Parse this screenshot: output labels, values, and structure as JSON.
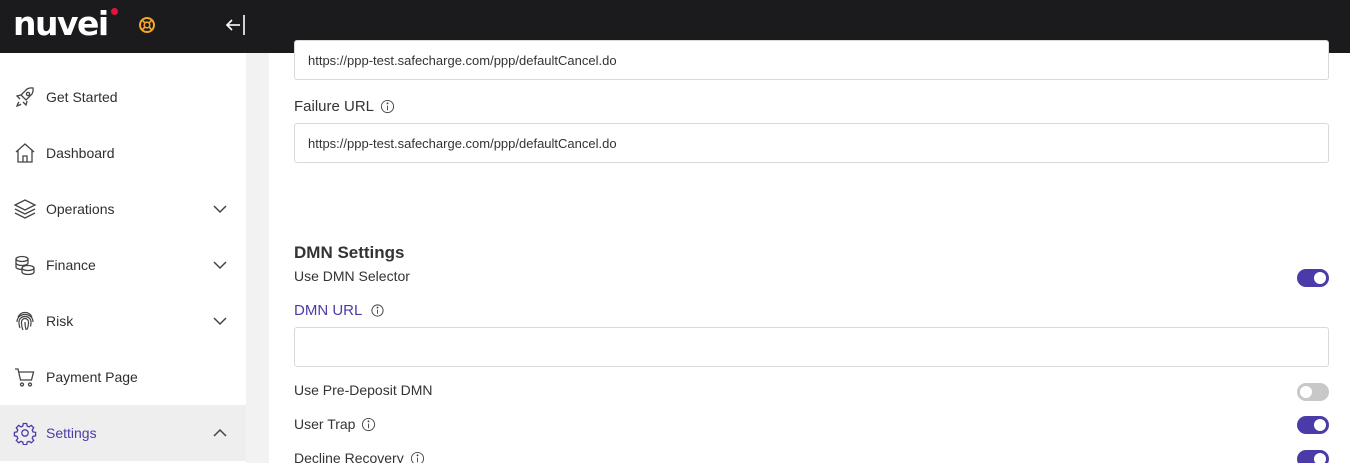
{
  "app": {
    "logo_text": "nuvei"
  },
  "sidebar": {
    "items": [
      {
        "label": "Get Started",
        "icon": "rocket-icon"
      },
      {
        "label": "Dashboard",
        "icon": "home-icon"
      },
      {
        "label": "Operations",
        "icon": "layers-icon",
        "expandable": true
      },
      {
        "label": "Finance",
        "icon": "coins-icon",
        "expandable": true
      },
      {
        "label": "Risk",
        "icon": "fingerprint-icon",
        "expandable": true
      },
      {
        "label": "Payment Page",
        "icon": "cart-icon"
      },
      {
        "label": "Settings",
        "icon": "gear-icon",
        "expandable": true,
        "expanded": true,
        "active": true
      }
    ]
  },
  "main": {
    "cancel_url_value": "https://ppp-test.safecharge.com/ppp/defaultCancel.do",
    "failure_url_label": "Failure URL",
    "failure_url_value": "https://ppp-test.safecharge.com/ppp/defaultCancel.do",
    "dmn_section_title": "DMN Settings",
    "use_dmn_selector_label": "Use DMN Selector",
    "use_dmn_selector_on": true,
    "dmn_url_label": "DMN URL",
    "dmn_url_value": "",
    "use_pre_deposit_label": "Use Pre-Deposit DMN",
    "use_pre_deposit_on": false,
    "user_trap_label": "User Trap",
    "user_trap_on": true,
    "decline_recovery_label": "Decline Recovery",
    "decline_recovery_on": true
  },
  "colors": {
    "accent": "#4a3ca8",
    "topbar": "#1b1b1e",
    "logo_dot": "#e5133a",
    "logo_mark": "#f5a623"
  }
}
